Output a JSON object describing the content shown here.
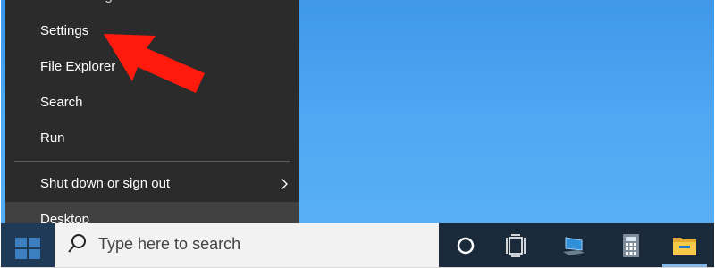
{
  "menu": {
    "partial_item_label": "Task Manager",
    "items": [
      {
        "label": "Settings"
      },
      {
        "label": "File Explorer"
      },
      {
        "label": "Search"
      },
      {
        "label": "Run"
      },
      {
        "label": "Shut down or sign out"
      },
      {
        "label": "Desktop"
      }
    ]
  },
  "taskbar": {
    "search_placeholder": "Type here to search",
    "pinned": [
      {
        "icon": "cortana-circle-icon"
      },
      {
        "icon": "task-view-icon"
      },
      {
        "icon": "this-pc-icon"
      },
      {
        "icon": "calculator-icon"
      },
      {
        "icon": "file-explorer-folder-icon"
      }
    ]
  },
  "colors": {
    "desktop_blue": "#4ea8f2",
    "menu_bg": "#2b2b2b",
    "menu_hover": "#414141",
    "taskbar_bg": "#1b2a3a",
    "annotation_arrow": "#ff0000"
  }
}
